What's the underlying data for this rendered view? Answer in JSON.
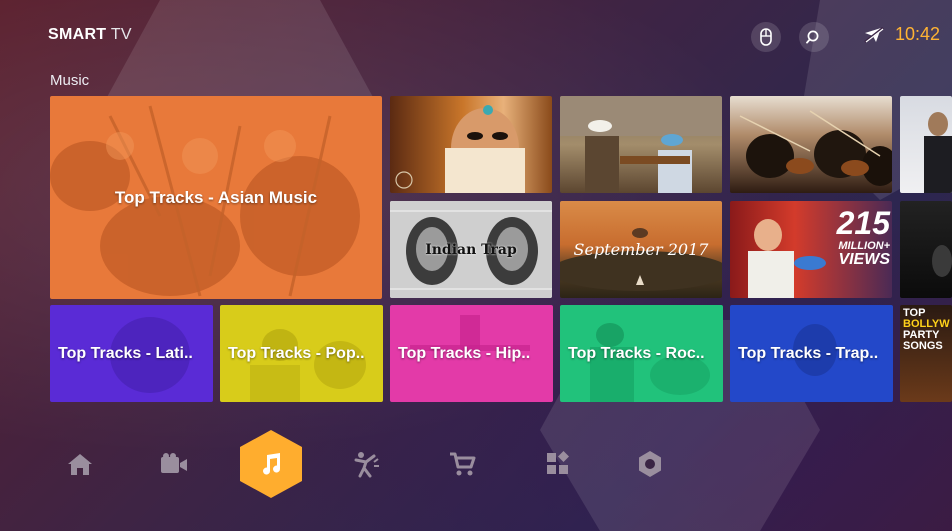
{
  "brand": {
    "bold": "SMART",
    "light": " TV"
  },
  "status": {
    "time": "10:42"
  },
  "section": {
    "title": "Music"
  },
  "tiles": {
    "featured": {
      "label": "Top Tracks - Asian Music"
    },
    "row": [
      {
        "label": "Top Tracks - Lati..",
        "color": "#5a2bd6"
      },
      {
        "label": "Top Tracks - Pop..",
        "color": "#d8cc1a"
      },
      {
        "label": "Top Tracks - Hip..",
        "color": "#e33aa8"
      },
      {
        "label": "Top Tracks - Roc..",
        "color": "#21c27b"
      },
      {
        "label": "Top Tracks - Trap..",
        "color": "#2348c9"
      }
    ],
    "thumbs": {
      "indian_trap": "Indian Trap",
      "september": "September 2017",
      "views_big": "215",
      "views_small1": "MILLION+",
      "views_small2": "VIEWS",
      "bolly1": "TOP",
      "bolly2": "BOLLYW",
      "bolly3": "PARTY",
      "bolly4": "SONGS"
    }
  },
  "nav": {
    "items": [
      "home-icon",
      "video-icon",
      "music-icon",
      "dance-icon",
      "cart-icon",
      "apps-icon",
      "settings-icon"
    ],
    "active": "music-icon",
    "accent": "#ffad2e"
  },
  "colors": {
    "featured": "#e8793a",
    "accent": "#ffb333"
  }
}
